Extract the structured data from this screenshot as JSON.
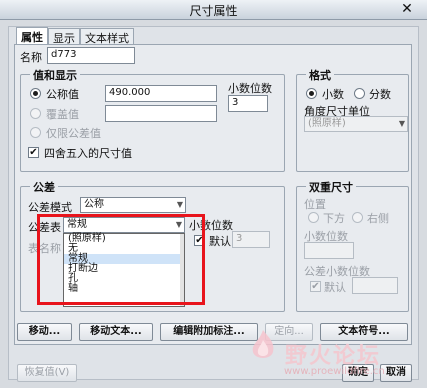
{
  "window": {
    "title": "尺寸属性",
    "close_glyph": "✕"
  },
  "tabs": [
    "属性",
    "显示",
    "文本样式"
  ],
  "name": {
    "label": "名称",
    "value": "d773"
  },
  "value_display": {
    "title": "值和显示",
    "nominal_label": "公称值",
    "nominal_value": "490.000",
    "override_label": "覆盖值",
    "tolerance_only_label": "仅限公差值",
    "decimals_label": "小数位数",
    "decimals_value": "3",
    "round_label": "四舍五入的尺寸值"
  },
  "format": {
    "title": "格式",
    "decimal_label": "小数",
    "fraction_label": "分数",
    "angle_unit_label": "角度尺寸单位",
    "angle_unit_value": "(照原样)"
  },
  "tolerance": {
    "title": "公差",
    "mode_label": "公差模式",
    "mode_value": "公称",
    "table_label": "公差表",
    "table_value": "常规",
    "table_name_label": "表名称",
    "decimals_label": "小数位数",
    "default_label": "默认",
    "decimals_value": "3",
    "options": [
      "(照原样)",
      "无",
      "常规",
      "打断边",
      "孔",
      "轴"
    ],
    "selected_index": 2
  },
  "dual": {
    "title": "双重尺寸",
    "position_label": "位置",
    "below_label": "下方",
    "right_label": "右侧",
    "decimals_label": "小数位数",
    "tol_decimals_label": "公差小数位数",
    "default_label": "默认"
  },
  "buttons": {
    "move": "移动...",
    "move_text": "移动文本...",
    "edit_attach": "编辑附加标注...",
    "orient": "定向...",
    "text_symbol": "文本符号...",
    "restore": "恢复值(V)",
    "ok": "确定",
    "cancel": "取消"
  },
  "watermark": {
    "text": "野火论坛",
    "url": "www.proewildfire.cn"
  }
}
